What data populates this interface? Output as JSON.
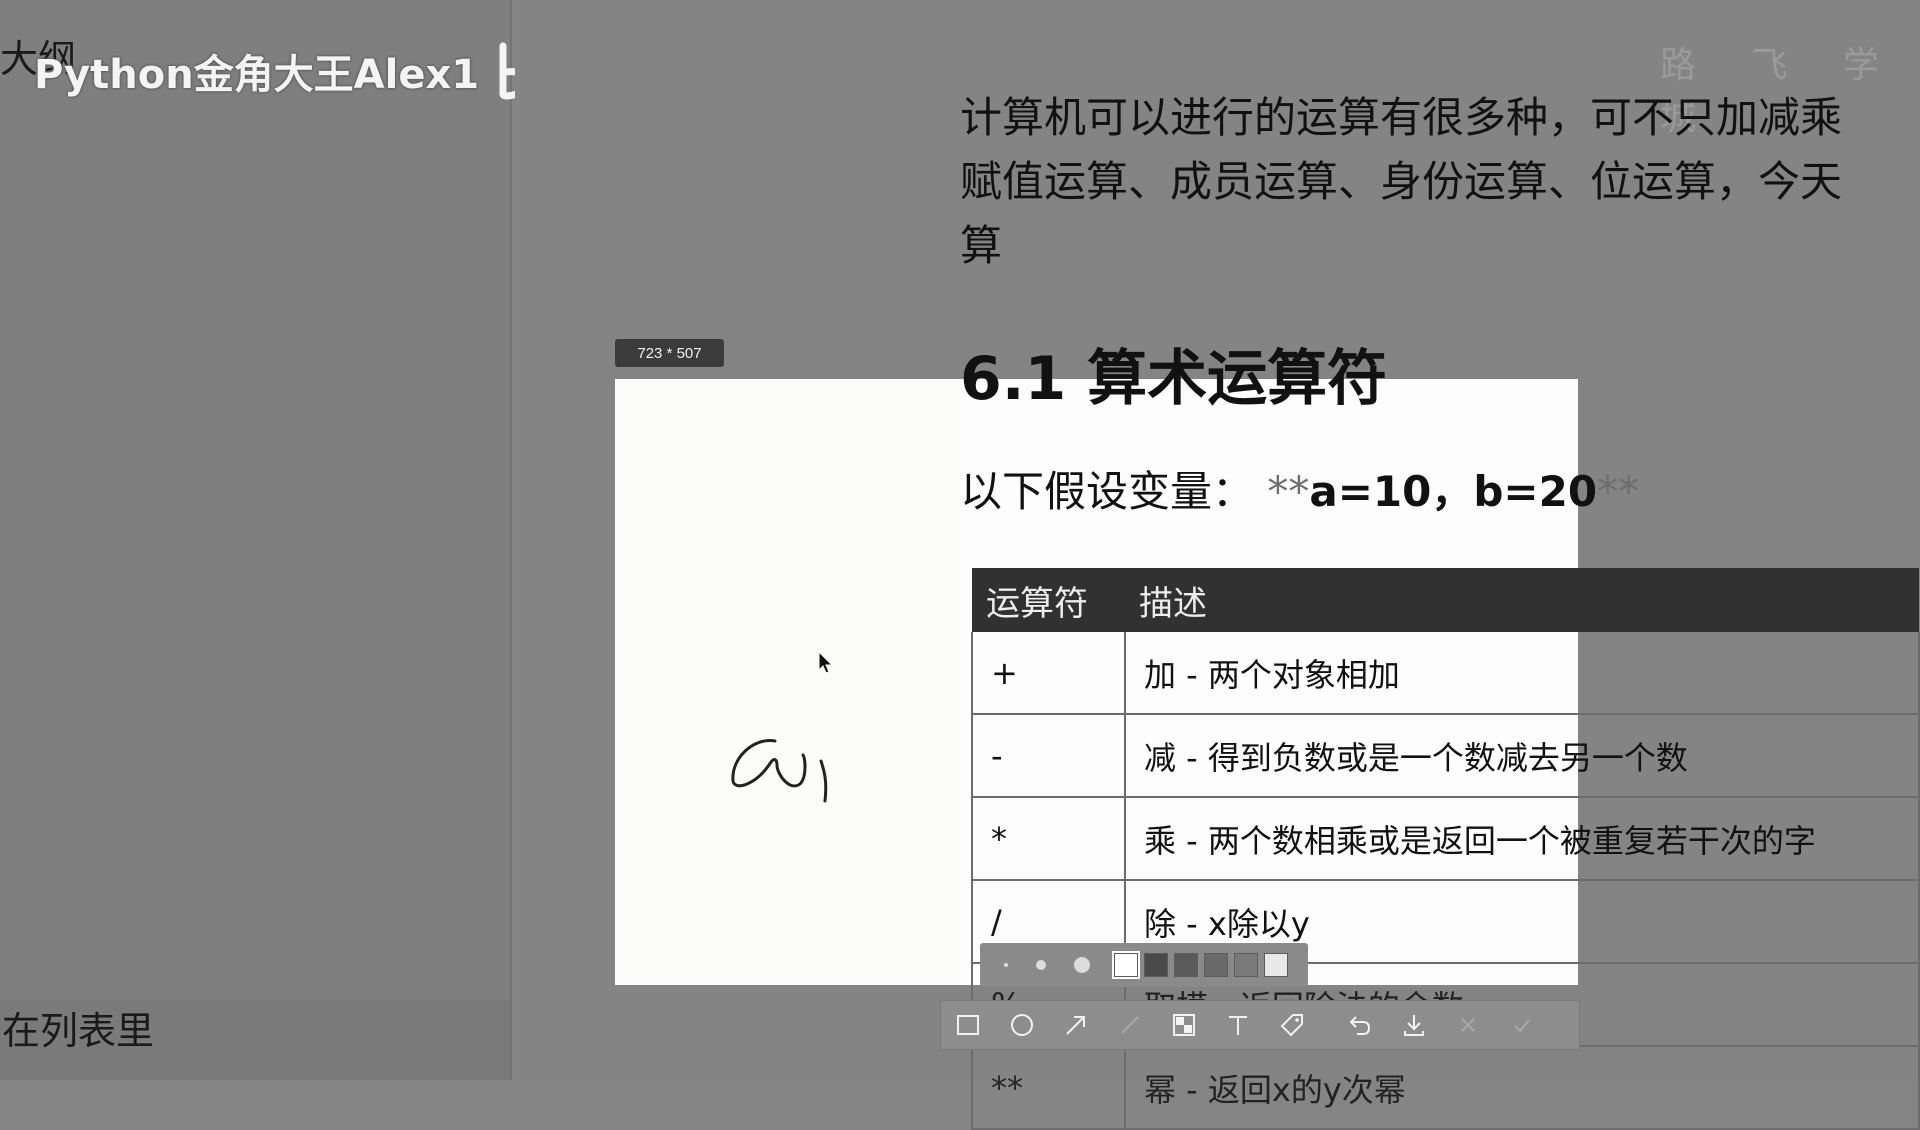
{
  "sidebar": {
    "outline_label": "大纲",
    "bottom_text": "在列表里"
  },
  "watermark": {
    "text": "Python金角大王Alex1",
    "logo": "bilibili"
  },
  "document": {
    "brand_mark": "路 飞 学 城",
    "paragraph_lines": [
      "计算机可以进行的运算有很多种，可不只加减乘",
      "赋值运算、成员运算、身份运算、位运算，今天",
      "算"
    ],
    "heading": "6.1 算术运算符",
    "assumption_prefix": "以下假设变量：",
    "assumption_stars_open": "**",
    "assumption_values": "a=10，b=20",
    "assumption_stars_close": "**",
    "table": {
      "headers": [
        "运算符",
        "描述"
      ],
      "rows": [
        [
          "+",
          "加 - 两个对象相加"
        ],
        [
          "-",
          "减 - 得到负数或是一个数减去另一个数"
        ],
        [
          "*",
          "乘 - 两个数相乘或是返回一个被重复若干次的字"
        ],
        [
          "/",
          "除 - x除以y"
        ],
        [
          "%",
          "取模 - 返回除法的余数"
        ],
        [
          "**",
          "幂 - 返回x的y次幂"
        ]
      ]
    }
  },
  "screenshot_tool": {
    "size_badge": "723 * 507",
    "handwriting": "a",
    "brush_sizes": [
      "small",
      "medium",
      "large"
    ],
    "colors": [
      "#ffffff",
      "#4a4a4a",
      "#5a5a5a",
      "#6a6a6a",
      "#7a7a7a",
      "#e8e8e8"
    ],
    "tools": [
      "rectangle-icon",
      "ellipse-icon",
      "arrow-icon",
      "pen-icon",
      "mosaic-icon",
      "text-icon",
      "tag-icon",
      "undo-icon",
      "download-icon",
      "close-icon",
      "confirm-icon"
    ]
  }
}
